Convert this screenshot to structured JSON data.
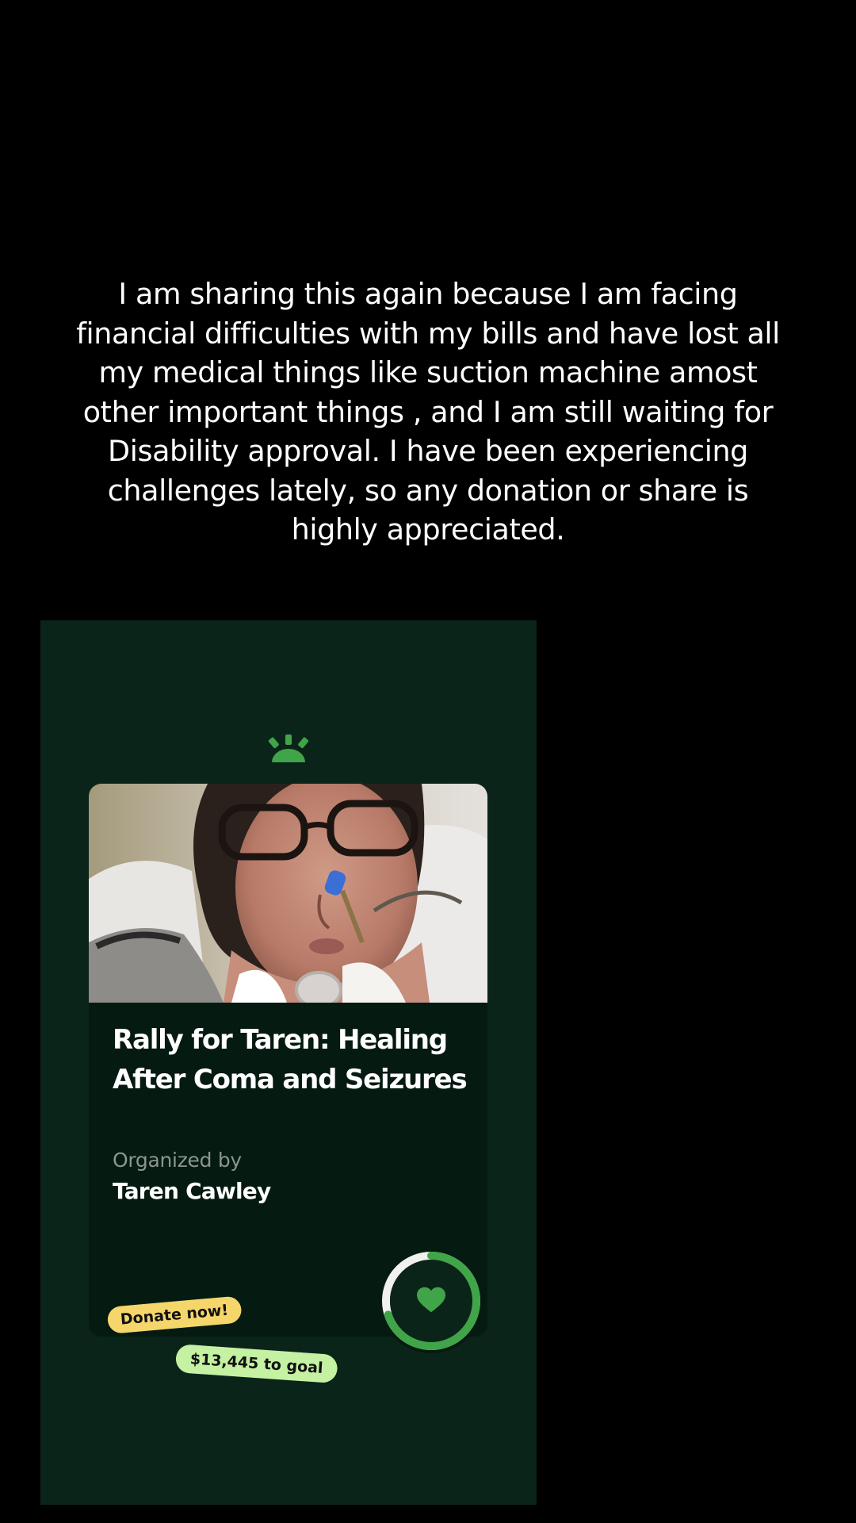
{
  "caption": "I am sharing this again because I am facing\nfinancial difficulties with my bills and have lost all\nmy medical things like suction machine amost\nother important  things  , and I am still waiting for\nDisability approval. I have been experiencing\nchallenges lately, so any donation or share is\nhighly appreciated.",
  "fundraiser": {
    "logo_icon": "gofundme-sunrise-icon",
    "photo_icon": "patient-photo",
    "title": "Rally for Taren: Healing After Coma and Seizures",
    "organized_by_label": "Organized by",
    "organizer_name": "Taren Cawley",
    "progress_fraction": 0.7,
    "progress_icon": "heart-icon",
    "donate_label": "Donate now!",
    "goal_label": "$13,445 to goal"
  },
  "colors": {
    "background": "#000000",
    "panel": "#0b241a",
    "card": "#051a11",
    "accent_green": "#3fa548",
    "donate_badge": "#f5d66b",
    "goal_badge": "#c4f1a2"
  }
}
